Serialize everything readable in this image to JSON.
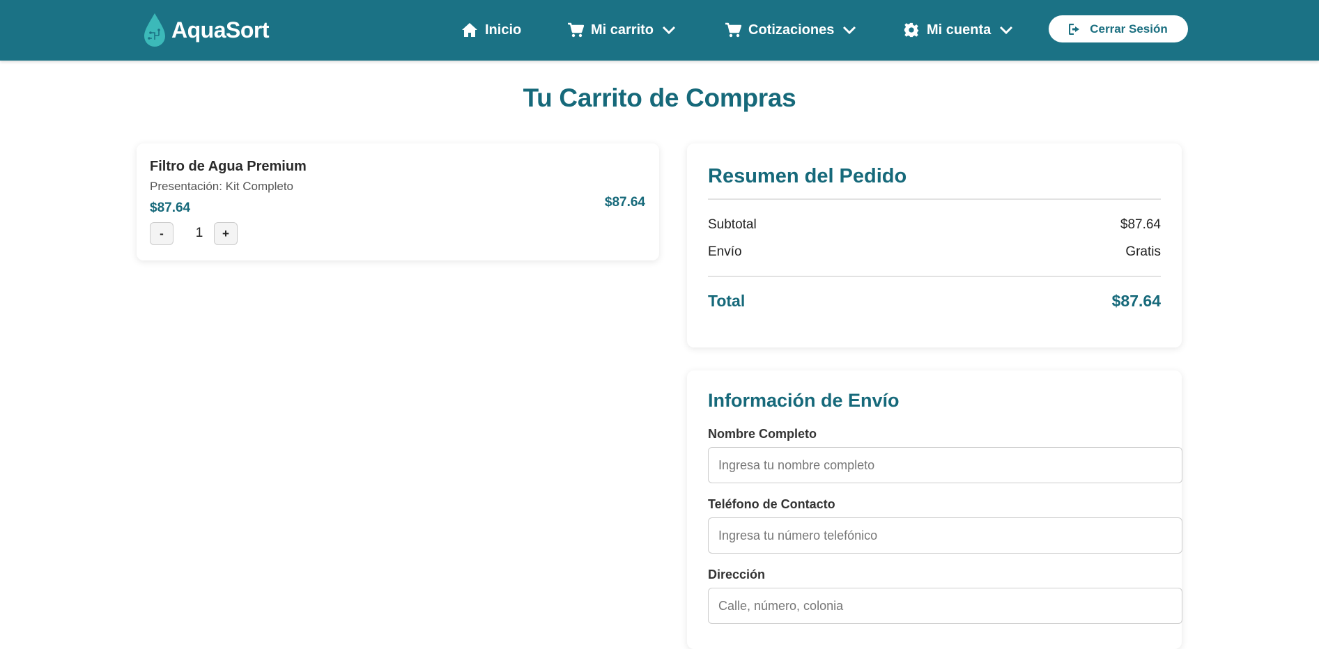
{
  "brand": {
    "name": "AquaSort",
    "logo_icon": "water-drop-circuit-icon"
  },
  "nav": {
    "home": {
      "label": "Inicio",
      "icon": "home-icon"
    },
    "cart": {
      "label": "Mi carrito",
      "icon": "cart-icon"
    },
    "quotes": {
      "label": "Cotizaciones",
      "icon": "cart-icon"
    },
    "account": {
      "label": "Mi cuenta",
      "icon": "gear-icon"
    },
    "logout": {
      "label": "Cerrar Sesión",
      "icon": "sign-out-icon"
    }
  },
  "page": {
    "title": "Tu Carrito de Compras"
  },
  "cart": {
    "items": [
      {
        "name": "Filtro de Agua Premium",
        "presentation": "Presentación: Kit Completo",
        "unit_price": "$87.64",
        "quantity": "1",
        "line_total": "$87.64",
        "decrement_label": "-",
        "increment_label": "+"
      }
    ]
  },
  "summary": {
    "title": "Resumen del Pedido",
    "subtotal_label": "Subtotal",
    "subtotal_value": "$87.64",
    "shipping_label": "Envío",
    "shipping_value": "Gratis",
    "total_label": "Total",
    "total_value": "$87.64"
  },
  "shipping": {
    "title": "Información de Envío",
    "name_label": "Nombre Completo",
    "name_placeholder": "Ingresa tu nombre completo",
    "phone_label": "Teléfono de Contacto",
    "phone_placeholder": "Ingresa tu número telefónico",
    "address_label": "Dirección",
    "address_placeholder": "Calle, número, colonia"
  },
  "colors": {
    "navbar": "#1b7285",
    "accent": "#16697a",
    "background": "#ffffff"
  }
}
